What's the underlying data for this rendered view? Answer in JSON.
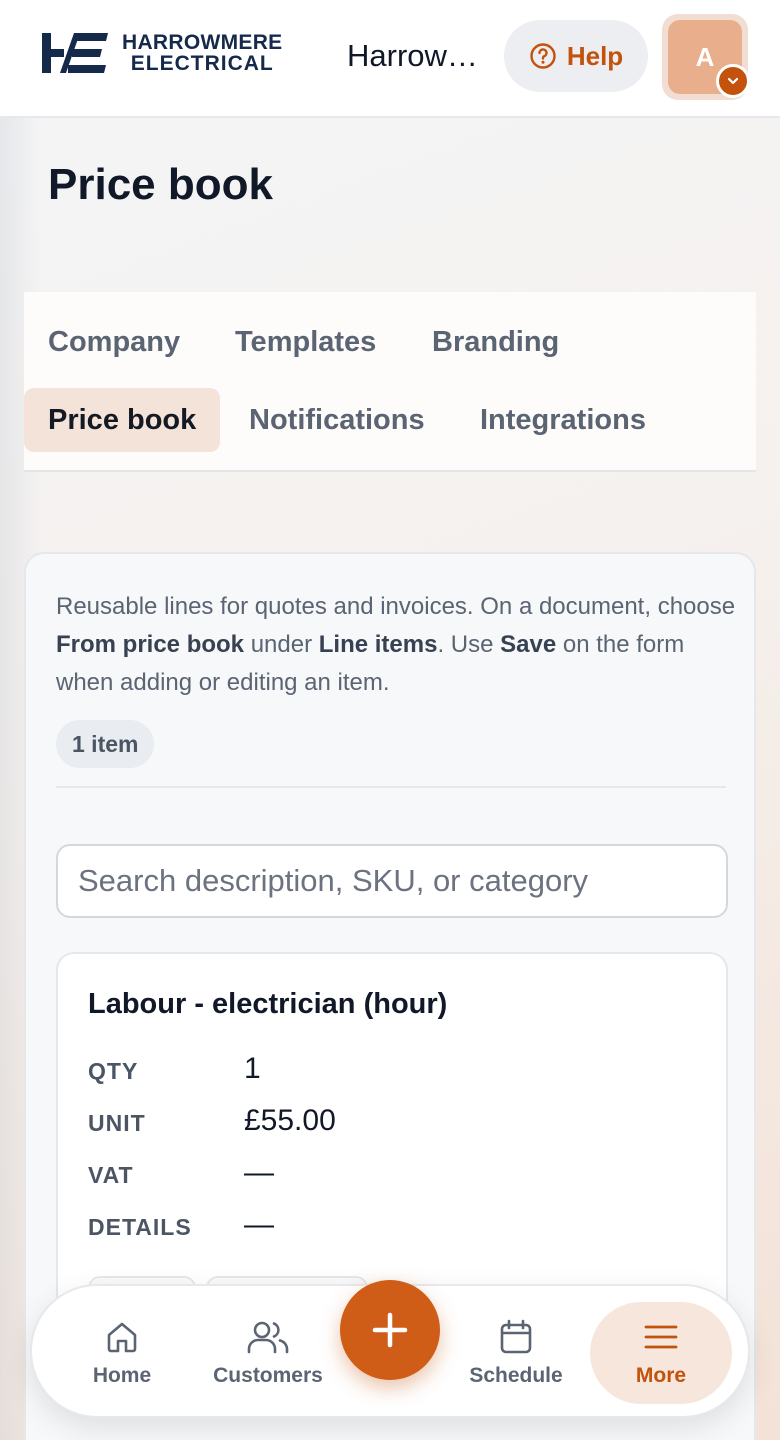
{
  "header": {
    "logo_line1": "HARROWMERE",
    "logo_line2": "ELECTRICAL",
    "company_name": "Harrowmere Electrical",
    "help_label": "Help",
    "avatar_initial": "A"
  },
  "page": {
    "title": "Price book"
  },
  "tabs": [
    {
      "label": "Company"
    },
    {
      "label": "Templates"
    },
    {
      "label": "Branding"
    },
    {
      "label": "Price book",
      "active": true
    },
    {
      "label": "Notifications"
    },
    {
      "label": "Integrations"
    }
  ],
  "intro": {
    "part1": "Reusable lines for quotes and invoices. On a document, choose ",
    "bold1": "From price book",
    "part2": " under ",
    "bold2": "Line items",
    "part3": ". Use ",
    "bold3": "Save",
    "part4": " on the form when adding or editing an item."
  },
  "count_badge": "1 item",
  "search": {
    "placeholder": "Search description, SKU, or category",
    "value": ""
  },
  "items": [
    {
      "title": "Labour - electrician (hour)",
      "qty_label": "QTY",
      "qty": "1",
      "unit_label": "UNIT",
      "unit": "£55.00",
      "vat_label": "VAT",
      "vat": "—",
      "details_label": "DETAILS",
      "details": "—"
    }
  ],
  "bottom_nav": {
    "home": "Home",
    "customers": "Customers",
    "schedule": "Schedule",
    "more": "More"
  },
  "colors": {
    "accent": "#c2520c",
    "fab": "#cf5d18",
    "active_tab_bg": "#f4e3d9"
  },
  "icons": {
    "help": "question-circle-icon",
    "avatar_caret": "chevron-down-icon",
    "home": "home-icon",
    "customers": "users-icon",
    "add": "plus-icon",
    "schedule": "calendar-icon",
    "more": "menu-icon"
  }
}
